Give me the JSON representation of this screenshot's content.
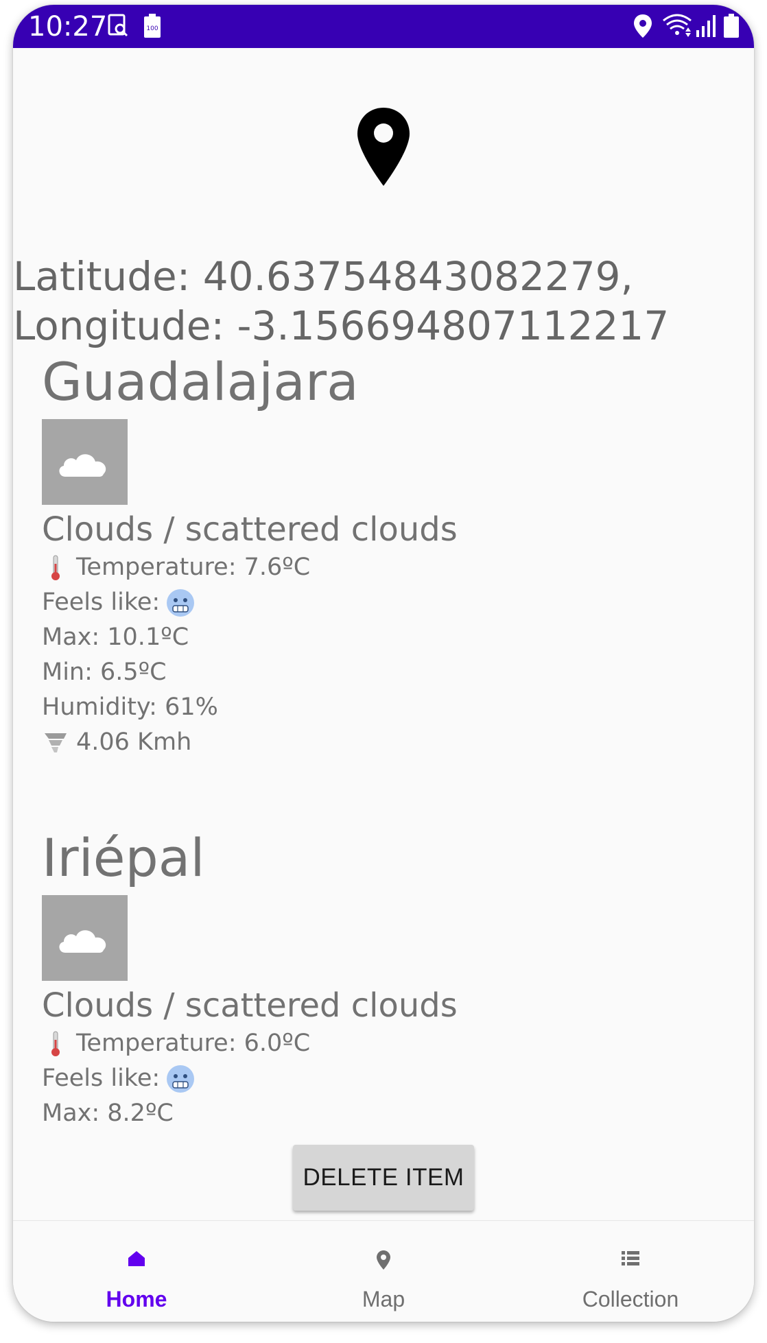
{
  "status_bar": {
    "time": "10:27",
    "battery_saver_label": "100",
    "icons": [
      "screenshot-icon",
      "battery-saver-icon",
      "location-icon",
      "wifi-icon",
      "signal-icon",
      "battery-icon"
    ]
  },
  "location": {
    "icon": "map-pin-icon",
    "latitude_line": "Latitude: 40.63754843082279,",
    "longitude_line": "Longitude: -3.156694807112217"
  },
  "cities": [
    {
      "name": "Guadalajara",
      "icon": "cloud-icon",
      "description": "Clouds / scattered clouds",
      "temperature": "Temperature: 7.6ºC",
      "feels_like": "Feels like:",
      "feels_like_emoji": "cold-face-emoji",
      "max": "Max: 10.1ºC",
      "min": "Min: 6.5ºC",
      "humidity": "Humidity: 61%",
      "wind": "4.06 Kmh"
    },
    {
      "name": "Iriépal",
      "icon": "cloud-icon",
      "description": "Clouds / scattered clouds",
      "temperature": "Temperature: 6.0ºC",
      "feels_like": "Feels like:",
      "feels_like_emoji": "cold-face-emoji",
      "max": "Max: 8.2ºC"
    }
  ],
  "delete_button": "DELETE ITEM",
  "bottom_nav": {
    "active": "Home",
    "items": [
      {
        "label": "Home",
        "icon": "home-icon"
      },
      {
        "label": "Map",
        "icon": "map-pin-icon"
      },
      {
        "label": "Collection",
        "icon": "list-icon"
      }
    ]
  },
  "colors": {
    "status_bar": "#3700b3",
    "accent": "#6200ee",
    "text_gray": "#727272",
    "image_placeholder": "#a6a6a6",
    "button_bg": "#d6d6d6"
  }
}
